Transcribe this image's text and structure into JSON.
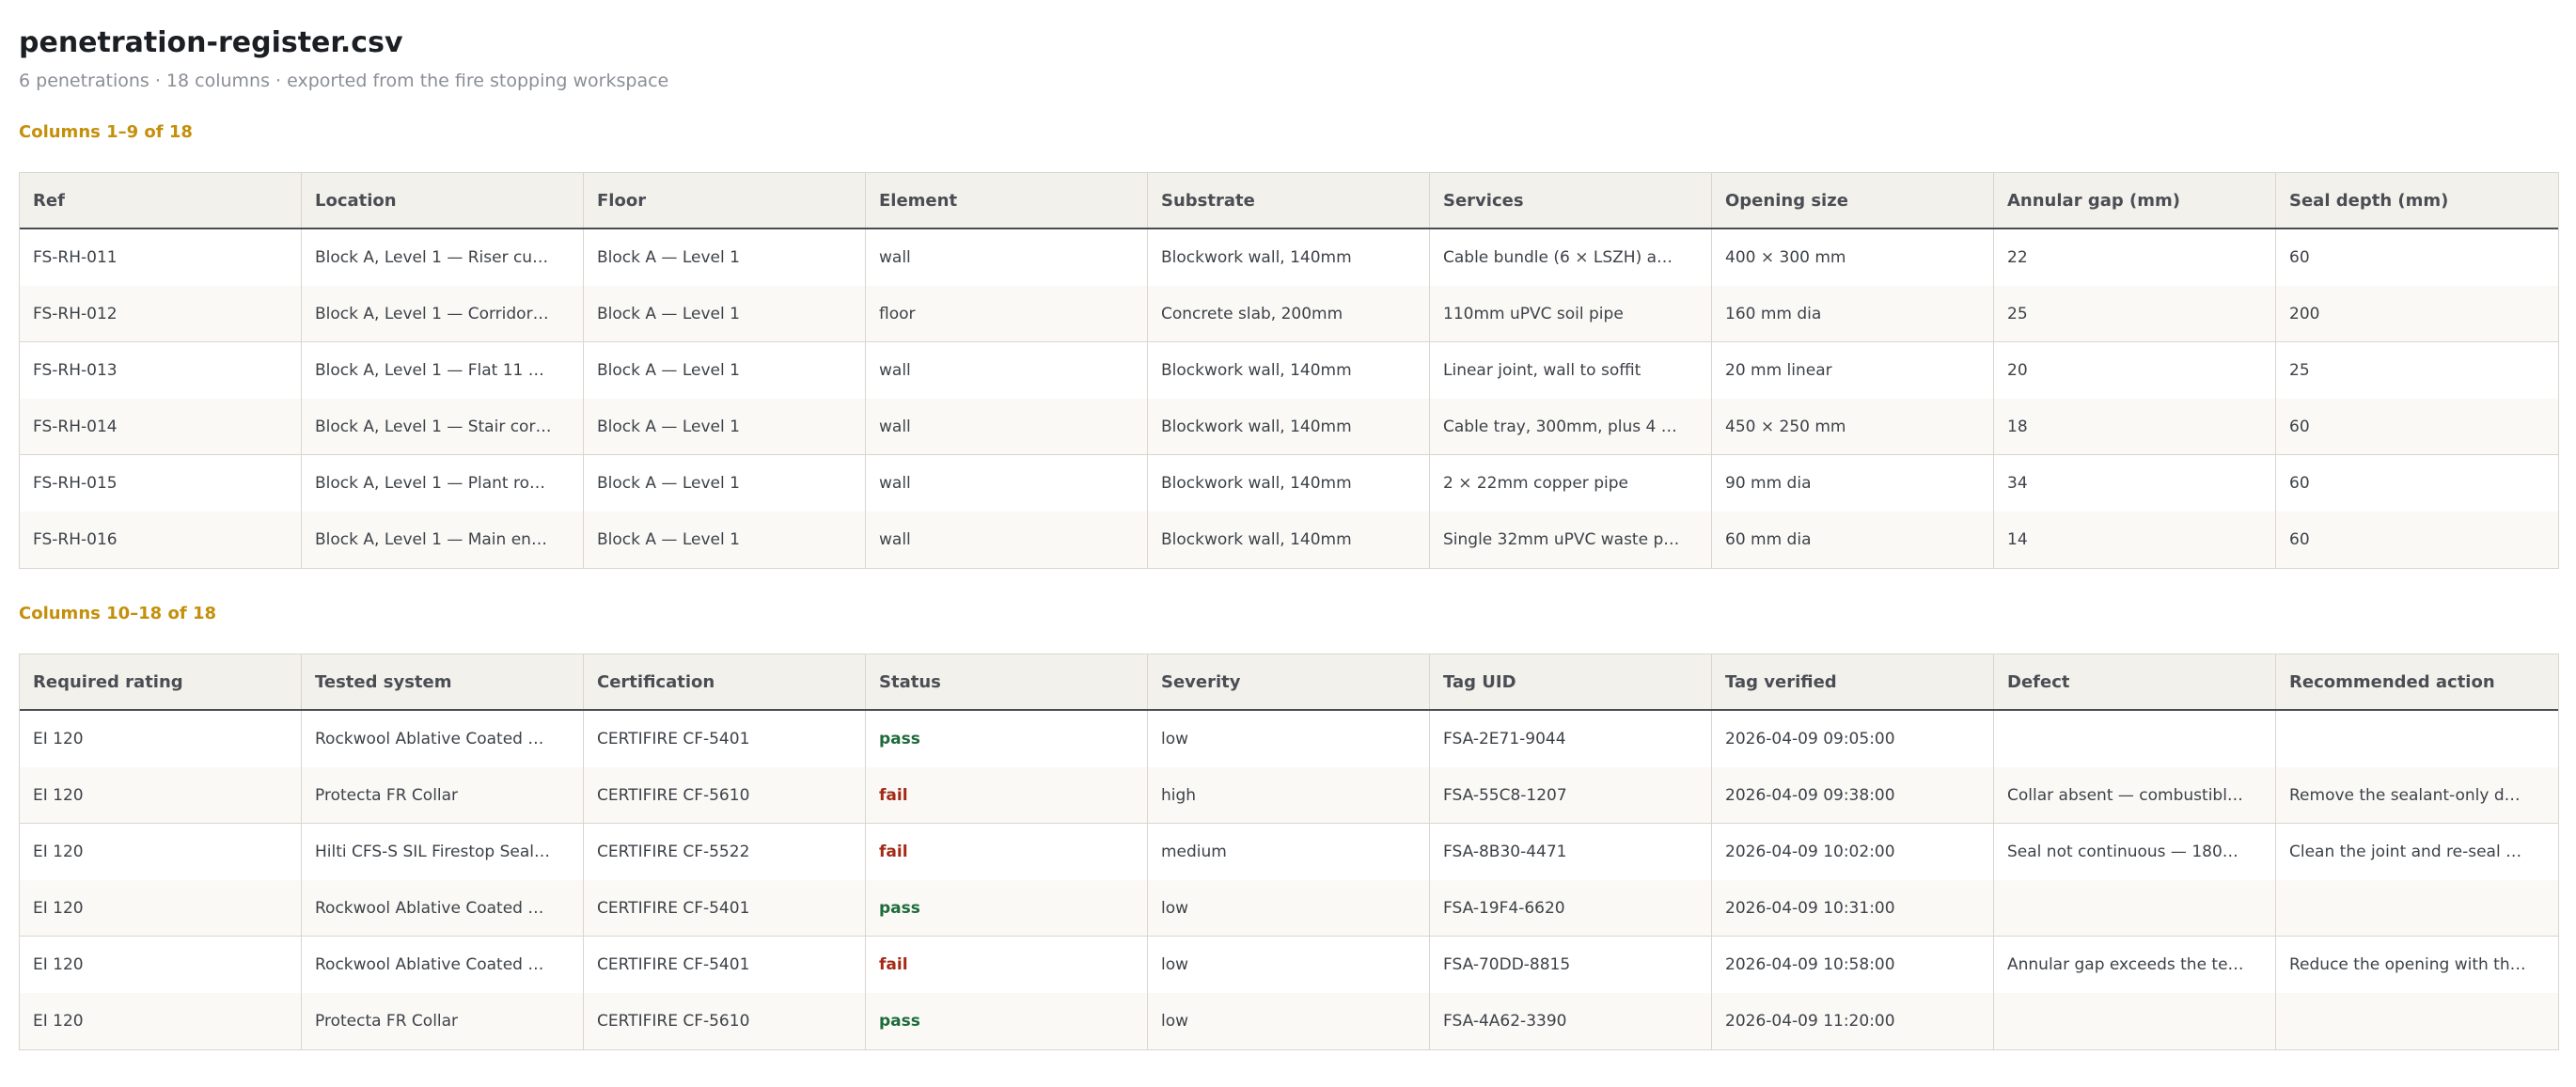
{
  "document": {
    "title": "penetration-register.csv",
    "subtitle": "6 penetrations · 18 columns · exported from the fire stopping workspace"
  },
  "section1": {
    "label": "Columns 1–9 of 18",
    "headers": [
      "Ref",
      "Location",
      "Floor",
      "Element",
      "Substrate",
      "Services",
      "Opening size",
      "Annular gap (mm)",
      "Seal depth (mm)"
    ],
    "rows": [
      [
        "FS-RH-011",
        "Block A, Level 1 — Riser cu…",
        "Block A — Level 1",
        "wall",
        "Blockwork wall, 140mm",
        "Cable bundle (6 × LSZH) a…",
        "400 × 300 mm",
        "22",
        "60"
      ],
      [
        "FS-RH-012",
        "Block A, Level 1 — Corridor…",
        "Block A — Level 1",
        "floor",
        "Concrete slab, 200mm",
        "110mm uPVC soil pipe",
        "160 mm dia",
        "25",
        "200"
      ],
      [
        "FS-RH-013",
        "Block A, Level 1 — Flat 11 …",
        "Block A — Level 1",
        "wall",
        "Blockwork wall, 140mm",
        "Linear joint, wall to soffit",
        "20 mm linear",
        "20",
        "25"
      ],
      [
        "FS-RH-014",
        "Block A, Level 1 — Stair cor…",
        "Block A — Level 1",
        "wall",
        "Blockwork wall, 140mm",
        "Cable tray, 300mm, plus 4 …",
        "450 × 250 mm",
        "18",
        "60"
      ],
      [
        "FS-RH-015",
        "Block A, Level 1 — Plant ro…",
        "Block A — Level 1",
        "wall",
        "Blockwork wall, 140mm",
        "2 × 22mm copper pipe",
        "90 mm dia",
        "34",
        "60"
      ],
      [
        "FS-RH-016",
        "Block A, Level 1 — Main en…",
        "Block A — Level 1",
        "wall",
        "Blockwork wall, 140mm",
        "Single 32mm uPVC waste p…",
        "60 mm dia",
        "14",
        "60"
      ]
    ]
  },
  "section2": {
    "label": "Columns 10–18 of 18",
    "headers": [
      "Required rating",
      "Tested system",
      "Certification",
      "Status",
      "Severity",
      "Tag UID",
      "Tag verified",
      "Defect",
      "Recommended action"
    ],
    "rows": [
      [
        "EI 120",
        "Rockwool Ablative Coated …",
        "CERTIFIRE CF-5401",
        "pass",
        "low",
        "FSA-2E71-9044",
        "2026-04-09 09:05:00",
        "",
        ""
      ],
      [
        "EI 120",
        "Protecta FR Collar",
        "CERTIFIRE CF-5610",
        "fail",
        "high",
        "FSA-55C8-1207",
        "2026-04-09 09:38:00",
        "Collar absent — combustibl…",
        "Remove the sealant-only d…"
      ],
      [
        "EI 120",
        "Hilti CFS-S SIL Firestop Seal…",
        "CERTIFIRE CF-5522",
        "fail",
        "medium",
        "FSA-8B30-4471",
        "2026-04-09 10:02:00",
        "Seal not continuous — 180…",
        "Clean the joint and re-seal …"
      ],
      [
        "EI 120",
        "Rockwool Ablative Coated …",
        "CERTIFIRE CF-5401",
        "pass",
        "low",
        "FSA-19F4-6620",
        "2026-04-09 10:31:00",
        "",
        ""
      ],
      [
        "EI 120",
        "Rockwool Ablative Coated …",
        "CERTIFIRE CF-5401",
        "fail",
        "low",
        "FSA-70DD-8815",
        "2026-04-09 10:58:00",
        "Annular gap exceeds the te…",
        "Reduce the opening with th…"
      ],
      [
        "EI 120",
        "Protecta FR Collar",
        "CERTIFIRE CF-5610",
        "pass",
        "low",
        "FSA-4A62-3390",
        "2026-04-09 11:20:00",
        "",
        ""
      ]
    ]
  },
  "colors": {
    "accent": "#c48f0b",
    "pass": "#1e6b3a",
    "fail": "#a32a16",
    "header_bg": "#f3f1ec",
    "stripe_bg": "#faf9f6",
    "border": "#d9d6cf"
  }
}
